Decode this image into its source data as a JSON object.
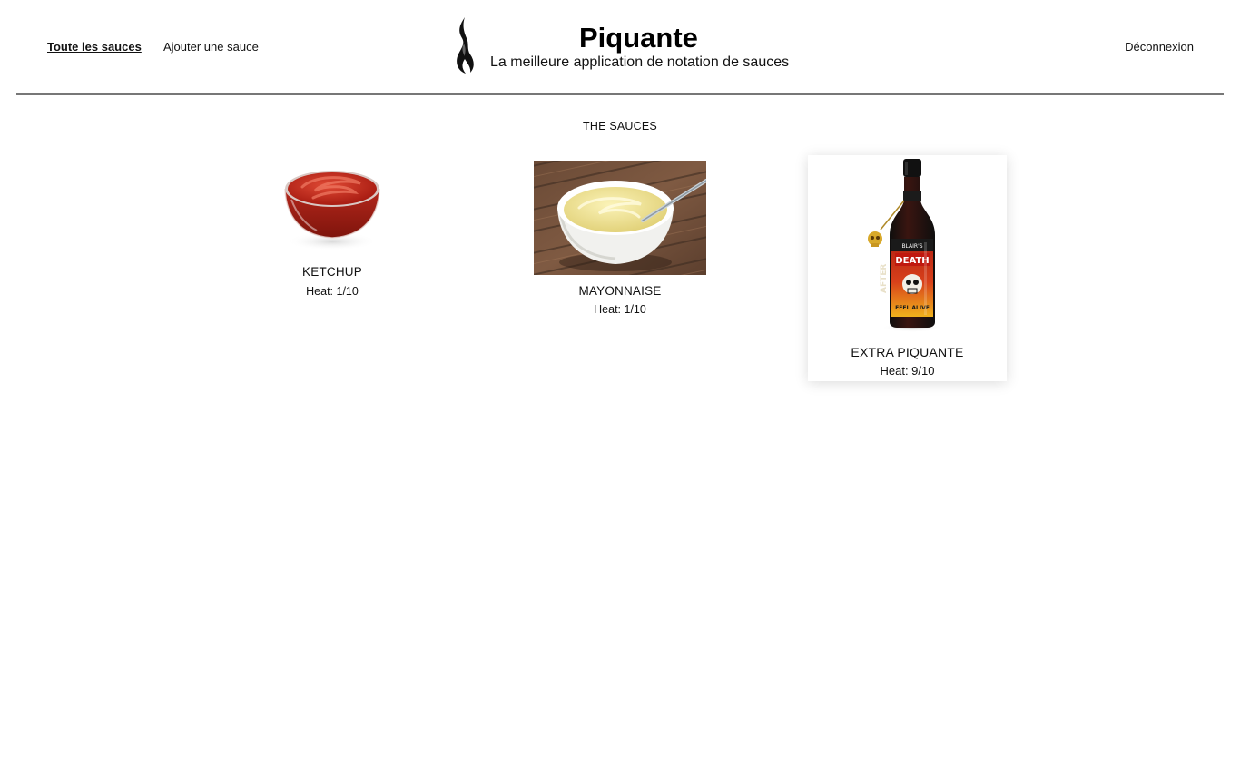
{
  "header": {
    "nav": {
      "all_sauces": "Toute les sauces",
      "add_sauce": "Ajouter une sauce",
      "logout": "Déconnexion"
    },
    "brand": {
      "title": "Piquante",
      "subtitle": "La meilleure application de notation de sauces",
      "logo_icon": "flame-icon"
    }
  },
  "main": {
    "section_title": "THE SAUCES",
    "sauces": [
      {
        "name": "KETCHUP",
        "heat": "Heat: 1/10",
        "heat_value": 1,
        "heat_max": 10,
        "image": "ketchup-bowl-image"
      },
      {
        "name": "MAYONNAISE",
        "heat": "Heat: 1/10",
        "heat_value": 1,
        "heat_max": 10,
        "image": "mayonnaise-bowl-image"
      },
      {
        "name": "EXTRA PIQUANTE",
        "heat": "Heat: 9/10",
        "heat_value": 9,
        "heat_max": 10,
        "image": "hot-sauce-bottle-image",
        "hovered": true
      }
    ]
  },
  "colors": {
    "background": "#ffffff",
    "text": "#111111",
    "divider": "#777777",
    "ketchup_red": "#c0281b",
    "mayo_yellow": "#efe49a",
    "bottle_dark": "#1a1a1a",
    "label_red": "#c8261a"
  }
}
